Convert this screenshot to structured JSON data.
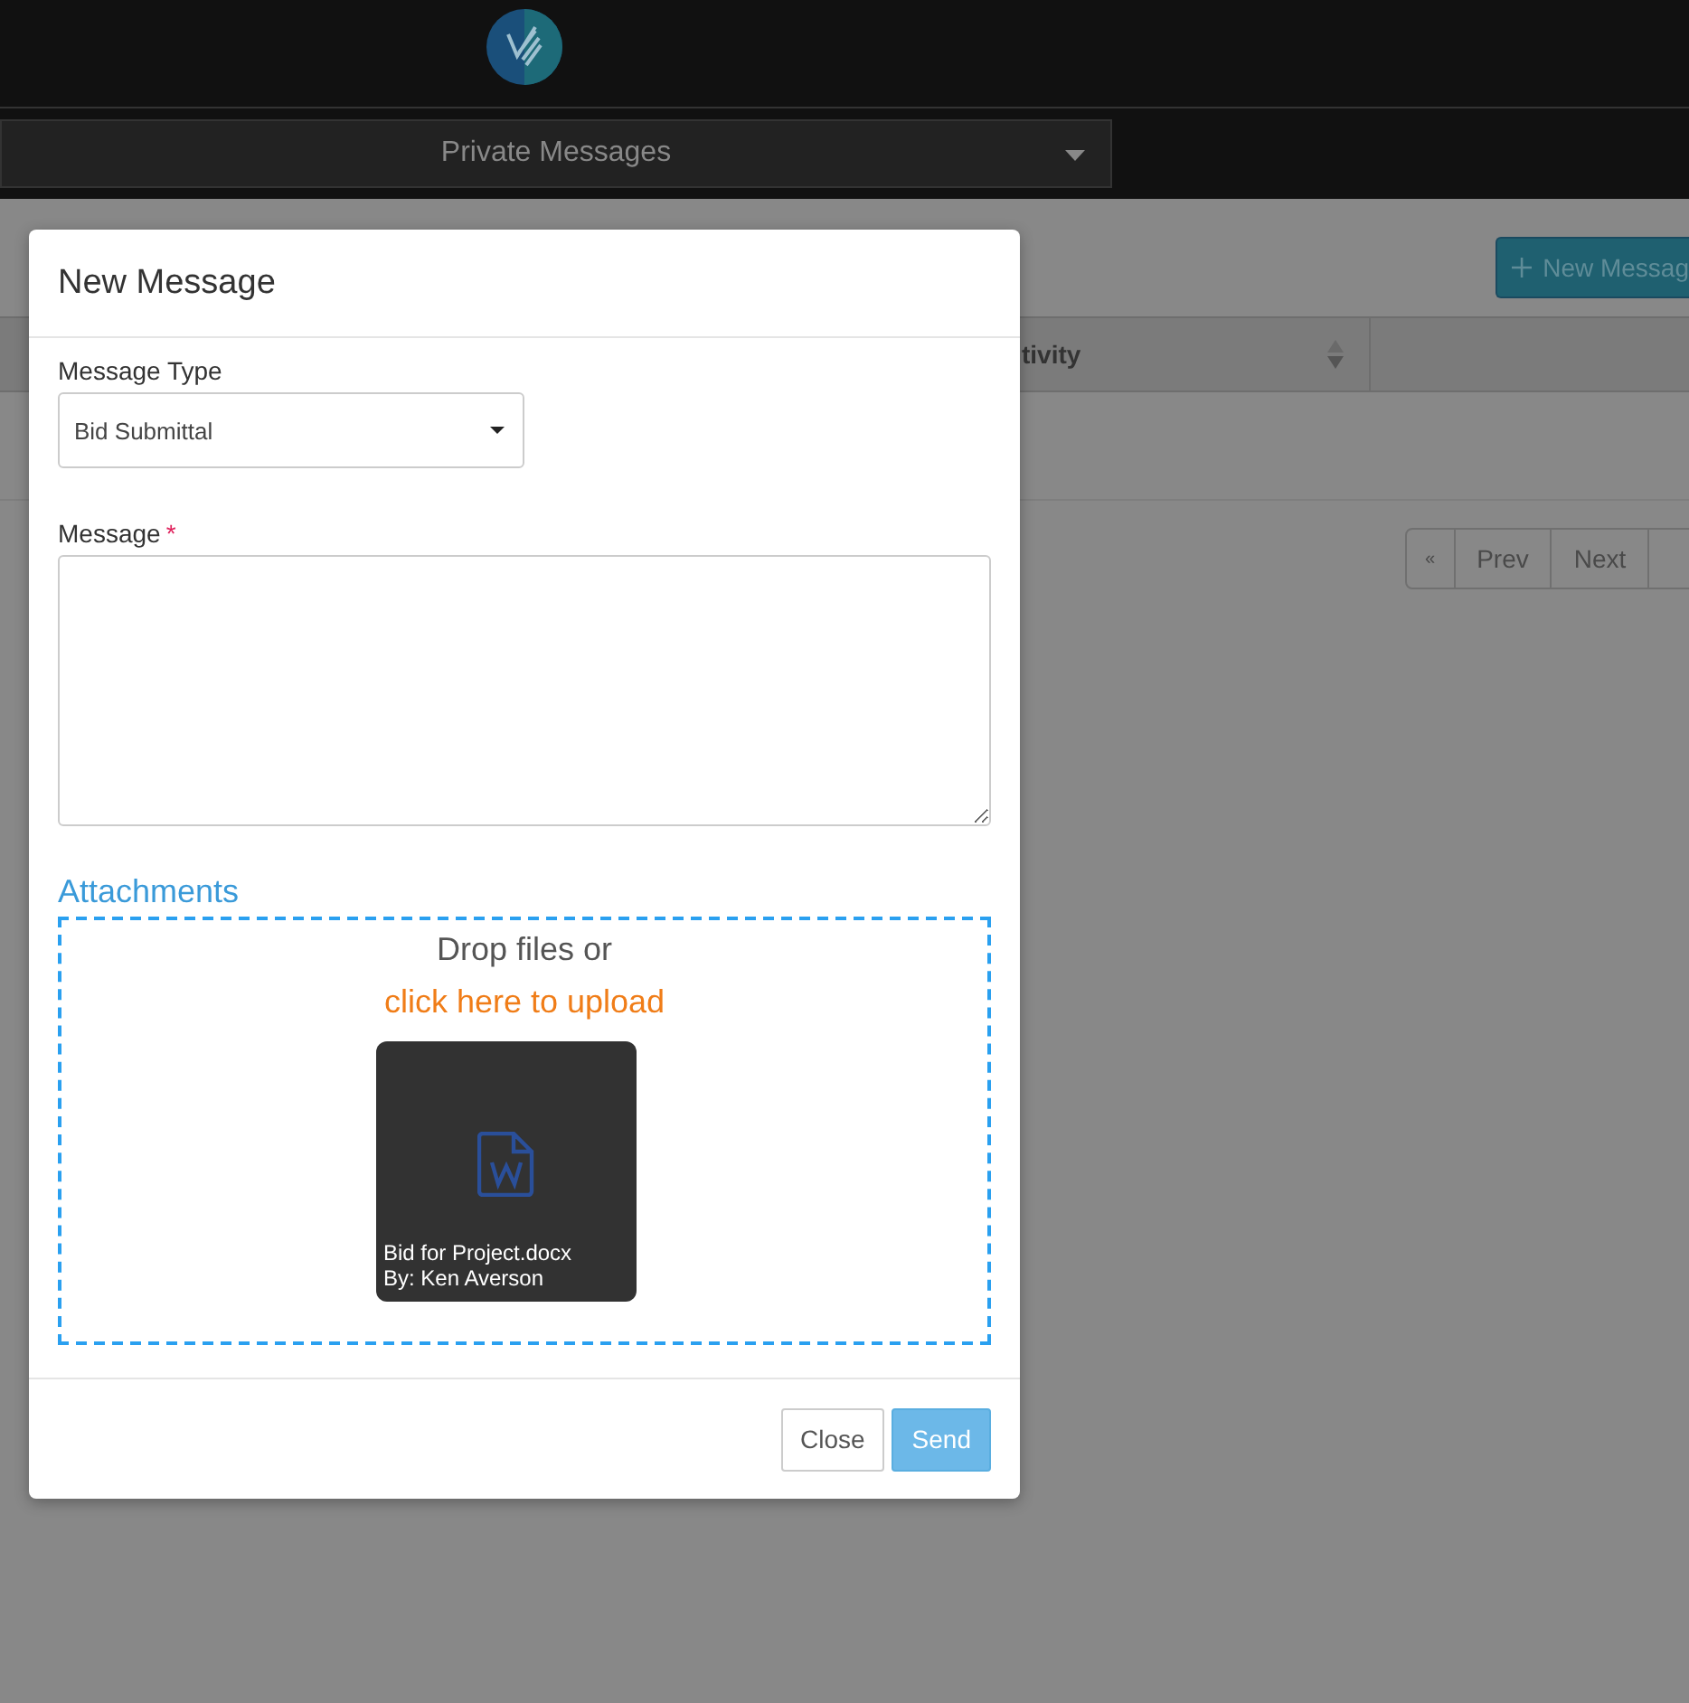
{
  "nav": {
    "dropdown": "Private Messages"
  },
  "page": {
    "new_button": "New Messag",
    "table_columns": [
      "tivity"
    ],
    "pagination": [
      "«",
      "Prev",
      "Next"
    ]
  },
  "modal": {
    "title": "New Message",
    "fields": [
      {
        "kind": "select",
        "label": "Message Type",
        "value": "Bid Submittal"
      },
      {
        "kind": "textarea",
        "label": "Message",
        "required_mark": "*"
      }
    ],
    "attachments": {
      "title": "Attachments",
      "drop_text": "Drop files or",
      "upload_link": "click here to upload",
      "files": [
        {
          "name": "Bid for Project.docx",
          "author": "By: Ken Averson"
        }
      ]
    },
    "buttons": [
      {
        "label": "Close",
        "kind": "default"
      },
      {
        "label": "Send",
        "kind": "primary"
      }
    ]
  }
}
